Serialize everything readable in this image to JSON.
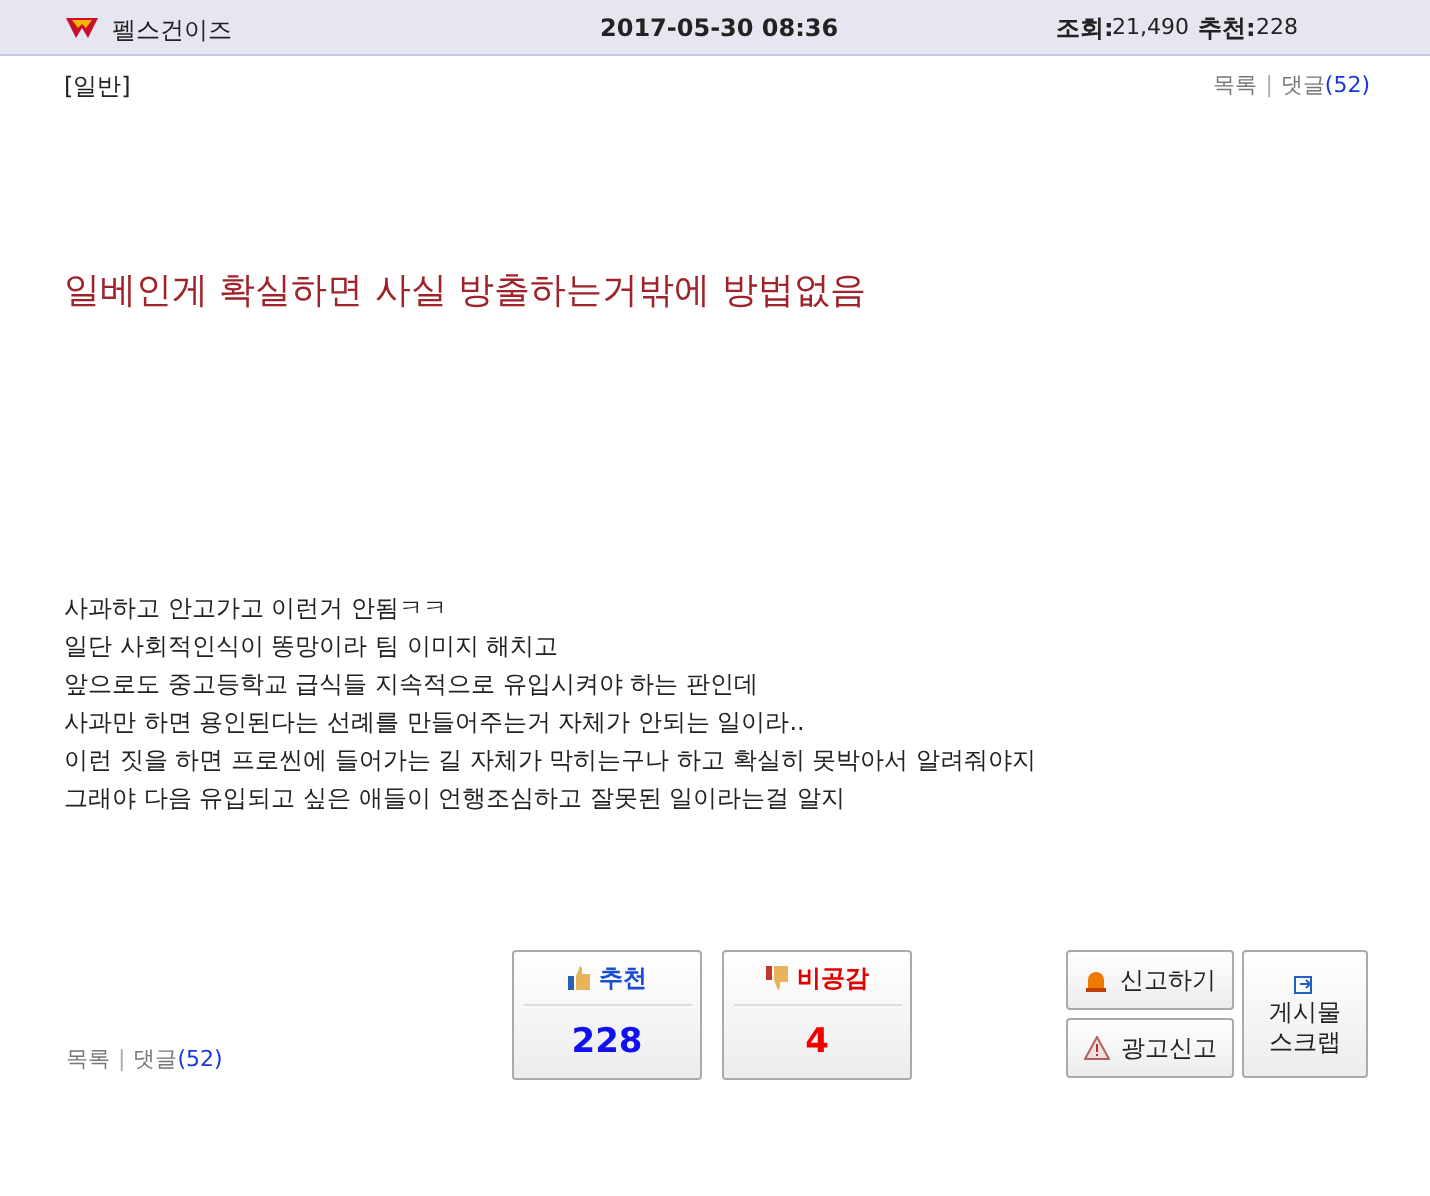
{
  "header": {
    "author": "펠스건이즈",
    "datetime": "2017-05-30 08:36",
    "views_label": "조회:",
    "views": "21,490",
    "recommend_label": "추천:",
    "recommend": "228"
  },
  "category": "[일반]",
  "top_nav": {
    "list": "목록",
    "separator": "|",
    "comments": "댓글",
    "comment_count": "(52)"
  },
  "title": "일베인게 확실하면 사실 방출하는거밖에 방법없음",
  "body": [
    "사과하고 안고가고 이런거 안됨ㅋㅋ",
    "일단 사회적인식이 똥망이라 팀 이미지 해치고",
    "앞으로도 중고등학교 급식들 지속적으로 유입시켜야 하는 판인데",
    "사과만 하면 용인된다는 선례를 만들어주는거 자체가 안되는 일이라..",
    "이런 짓을 하면 프로씬에 들어가는 길 자체가 막히는구나 하고 확실히 못박아서 알려줘야지",
    "그래야 다음 유입되고 싶은 애들이 언행조심하고 잘못된 일이라는걸 알지"
  ],
  "votes": [
    {
      "kind": "up",
      "label": "추천",
      "count": "228"
    },
    {
      "kind": "down",
      "label": "비공감",
      "count": "4"
    }
  ],
  "actions": [
    {
      "kind": "report",
      "label": "신고하기"
    },
    {
      "kind": "ad_report",
      "label": "광고신고"
    }
  ],
  "scrap": {
    "label": "게시물\n스크랩"
  },
  "bottom_nav": {
    "list": "목록",
    "separator": "|",
    "comments": "댓글",
    "comment_count": "(52)"
  }
}
